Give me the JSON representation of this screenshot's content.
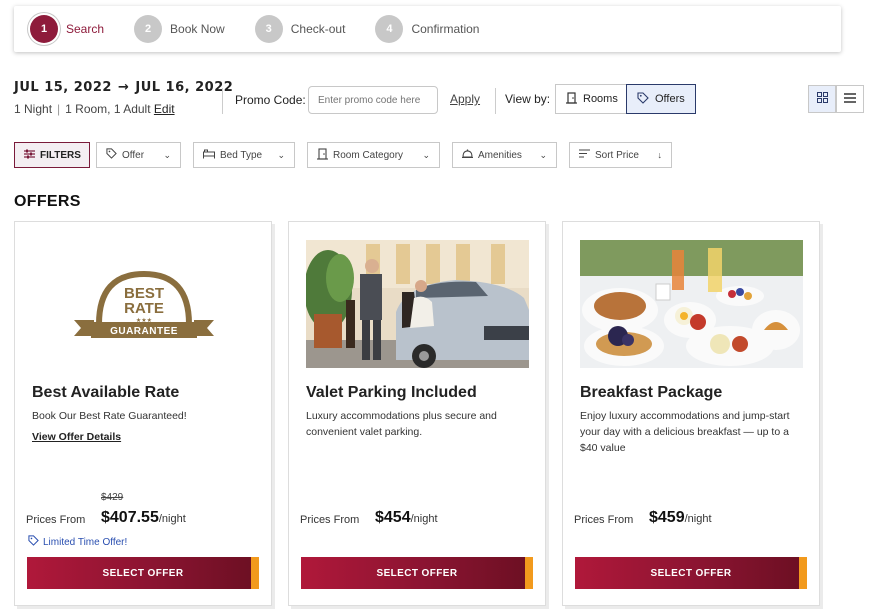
{
  "stepper": {
    "steps": [
      {
        "num": "1",
        "label": "Search"
      },
      {
        "num": "2",
        "label": "Book Now"
      },
      {
        "num": "3",
        "label": "Check-out"
      },
      {
        "num": "4",
        "label": "Confirmation"
      }
    ]
  },
  "summary": {
    "check_in": "JUL 15, 2022",
    "arrow": "→",
    "check_out": "JUL 16, 2022",
    "nights": "1 Night",
    "sep": "|",
    "rooms_adults": "1 Room, 1 Adult",
    "edit": "Edit"
  },
  "promo": {
    "label": "Promo Code:",
    "placeholder": "Enter promo code here",
    "apply": "Apply"
  },
  "view": {
    "label": "View by:",
    "rooms": "Rooms",
    "offers": "Offers"
  },
  "filters": {
    "filters_label": "FILTERS",
    "offer": "Offer",
    "bed_type": "Bed Type",
    "room_category": "Room Category",
    "amenities": "Amenities",
    "sort_price": "Sort Price"
  },
  "section_title": "OFFERS",
  "logo": {
    "line1": "BEST",
    "line2": "RATE",
    "stars": "★★★",
    "banner": "GUARANTEE"
  },
  "cards": [
    {
      "title": "Best Available Rate",
      "description": "Book Our Best Rate Guaranteed!",
      "details_link": "View Offer Details",
      "old_price": "$429",
      "price_from": "Prices From",
      "price": "$407.55",
      "per": "/night",
      "badge": "Limited Time Offer!",
      "button": "SELECT OFFER"
    },
    {
      "title": "Valet Parking Included",
      "description": "Luxury accommodations plus secure and convenient valet parking.",
      "price_from": "Prices From",
      "price": "$454",
      "per": "/night",
      "button": "SELECT OFFER"
    },
    {
      "title": "Breakfast Package",
      "description": "Enjoy luxury accommodations and jump-start your day with a delicious breakfast — up to a $40 value",
      "price_from": "Prices From",
      "price": "$459",
      "per": "/night",
      "button": "SELECT OFFER"
    }
  ],
  "colors": {
    "brand": "#8e1b3b",
    "accent": "#f29a1d",
    "link_blue": "#2a4fb0"
  }
}
